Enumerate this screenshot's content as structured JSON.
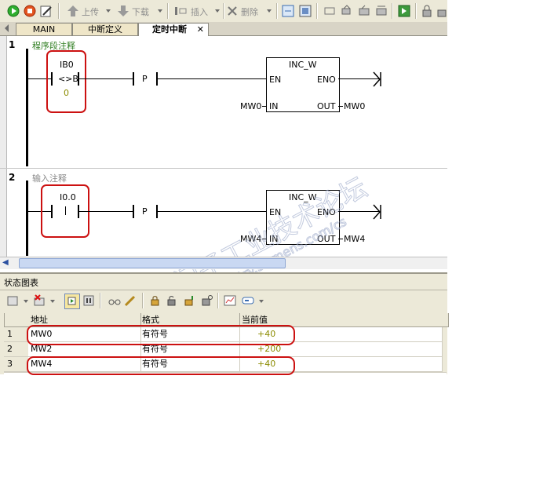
{
  "toolbar": {
    "upload_label": "上传",
    "download_label": "下载",
    "insert_label": "插入",
    "delete_label": "删除"
  },
  "tabs": [
    {
      "label": "MAIN"
    },
    {
      "label": "中断定义"
    },
    {
      "label": "定时中断"
    }
  ],
  "networks": [
    {
      "number": "1",
      "comment": "程序段注释",
      "contact_address": "IB0",
      "contact_symbol": "<>B",
      "contact_operand": "0",
      "edge_label": "P",
      "box_title": "INC_W",
      "en_label": "EN",
      "eno_label": "ENO",
      "in_label": "IN",
      "out_label": "OUT",
      "in_operand": "MW0",
      "out_operand": "MW0"
    },
    {
      "number": "2",
      "comment": "输入注释",
      "contact_address": "I0.0",
      "edge_label": "P",
      "box_title": "INC_W",
      "en_label": "EN",
      "eno_label": "ENO",
      "in_label": "IN",
      "out_label": "OUT",
      "in_operand": "MW4",
      "out_operand": "MW4"
    }
  ],
  "status_chart": {
    "title": "状态图表",
    "columns": [
      "地址",
      "格式",
      "当前值"
    ],
    "rows": [
      {
        "num": "1",
        "address": "MW0",
        "format": "有符号",
        "value": "+40"
      },
      {
        "num": "2",
        "address": "MW2",
        "format": "有符号",
        "value": "+200"
      },
      {
        "num": "3",
        "address": "MW4",
        "format": "有符号",
        "value": "+40"
      }
    ]
  },
  "watermark": "西门子工业技术论坛 support.industry.siemens.com/cs",
  "colors": {
    "comment_green": "#2e7d1f",
    "value_olive": "#8b8b00",
    "highlight_red": "#cc1111"
  }
}
